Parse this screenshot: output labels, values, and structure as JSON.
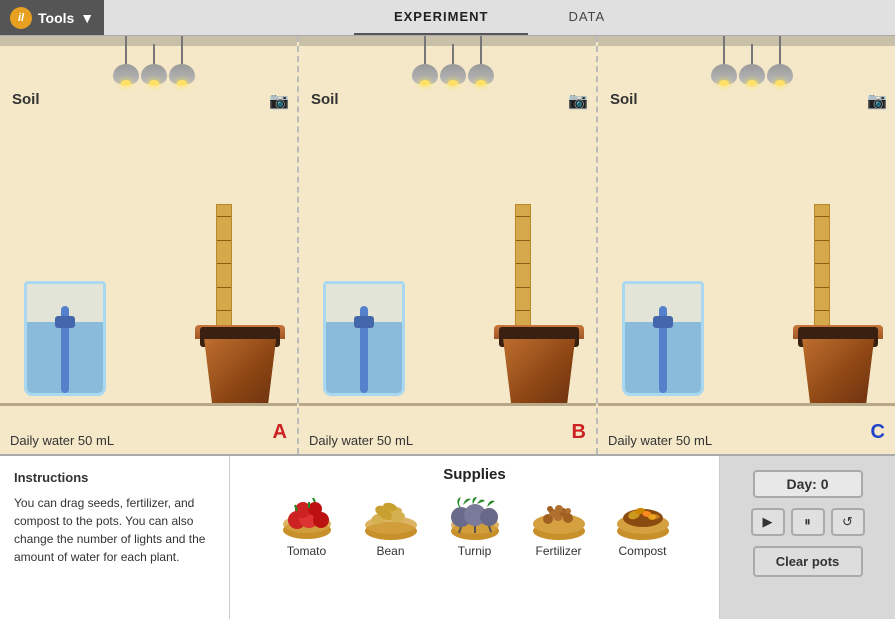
{
  "header": {
    "tools_label": "Tools",
    "tab_experiment": "EXPERIMENT",
    "tab_data": "DATA"
  },
  "pots": [
    {
      "id": "A",
      "soil_label": "Soil",
      "daily_water_label": "Daily water",
      "daily_water_value": "50",
      "daily_water_unit": "mL",
      "letter": "A",
      "letter_color": "#cc2222"
    },
    {
      "id": "B",
      "soil_label": "Soil",
      "daily_water_label": "Daily water",
      "daily_water_value": "50",
      "daily_water_unit": "mL",
      "letter": "B",
      "letter_color": "#cc2222"
    },
    {
      "id": "C",
      "soil_label": "Soil",
      "daily_water_label": "Daily water",
      "daily_water_value": "50",
      "daily_water_unit": "mL",
      "letter": "C",
      "letter_color": "#2244cc"
    }
  ],
  "instructions": {
    "title": "Instructions",
    "text": "You can drag seeds, fertilizer, and compost to the pots. You can also change the number of lights and the amount of water for each plant."
  },
  "supplies": {
    "title": "Supplies",
    "items": [
      {
        "id": "tomato",
        "label": "Tomato"
      },
      {
        "id": "bean",
        "label": "Bean"
      },
      {
        "id": "turnip",
        "label": "Turnip"
      },
      {
        "id": "fertilizer",
        "label": "Fertilizer"
      },
      {
        "id": "compost",
        "label": "Compost"
      }
    ]
  },
  "controls": {
    "day_label": "Day: 0",
    "play_icon": "▶",
    "pause_icon": "⏸",
    "reset_icon": "↺",
    "clear_label": "Clear pots"
  }
}
